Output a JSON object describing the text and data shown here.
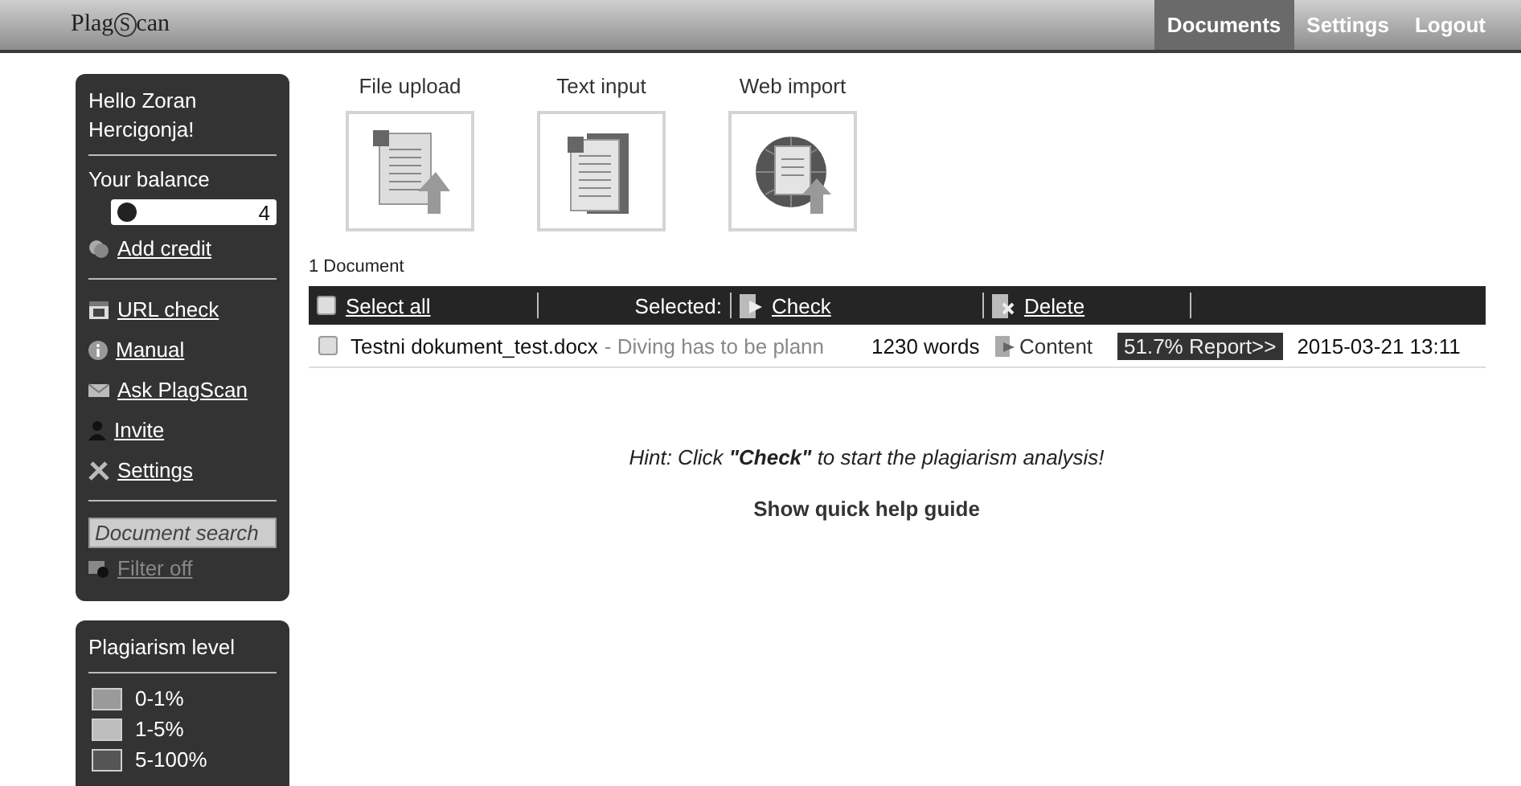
{
  "top_bar": {
    "logo": {
      "before": "Plag",
      "mark": "S",
      "after": "can"
    },
    "nav": [
      {
        "label": "Documents",
        "selected": true
      },
      {
        "label": "Settings",
        "selected": false
      },
      {
        "label": "Logout",
        "selected": false
      }
    ]
  },
  "sidebar": {
    "greeting": "Hello Zoran Hercigonja!",
    "balance_label": "Your balance",
    "balance": "4",
    "credit_link": {
      "label": "Add credit",
      "kind": "coin"
    },
    "links": [
      {
        "label": "URL check",
        "kind": "calendar"
      },
      {
        "label": "Manual",
        "kind": "info"
      },
      {
        "label": "Ask PlagScan",
        "kind": "mail"
      },
      {
        "label": "Invite",
        "kind": "person"
      },
      {
        "label": "Settings",
        "kind": "tools"
      }
    ],
    "search": {
      "placeholder": "Document search"
    },
    "filter": {
      "label": "Filter off",
      "disabled": true
    }
  },
  "legend": {
    "title": "Plagiarism level",
    "items": [
      {
        "label": "0-1%",
        "color": "#9a9a9a"
      },
      {
        "label": "1-5%",
        "color": "#bdbdbd"
      },
      {
        "label": "5-100%",
        "color": "#555555"
      }
    ]
  },
  "upload_options": [
    {
      "label": "File upload",
      "kind": "file"
    },
    {
      "label": "Text input",
      "kind": "text"
    },
    {
      "label": "Web import",
      "kind": "web"
    }
  ],
  "documents": {
    "count": "1 Document",
    "header": {
      "select_all": {
        "label": "Select all",
        "checked": false
      },
      "selected_label": "Selected:",
      "actions": [
        {
          "label": "Check",
          "kind": "check"
        },
        {
          "label": "Delete",
          "kind": "delete"
        }
      ]
    },
    "rows": [
      {
        "checked": false,
        "filename": "Testni dokument_test.docx",
        "preview": "- Diving has to be plann",
        "words": "1230 words",
        "content": "Content",
        "report": "51.7% Report>>",
        "date": "2015-03-21 13:11"
      }
    ]
  },
  "hint": "Hint: Click **\"Check\"** to start the plagiarism analysis!",
  "help_link": "Show quick help guide"
}
